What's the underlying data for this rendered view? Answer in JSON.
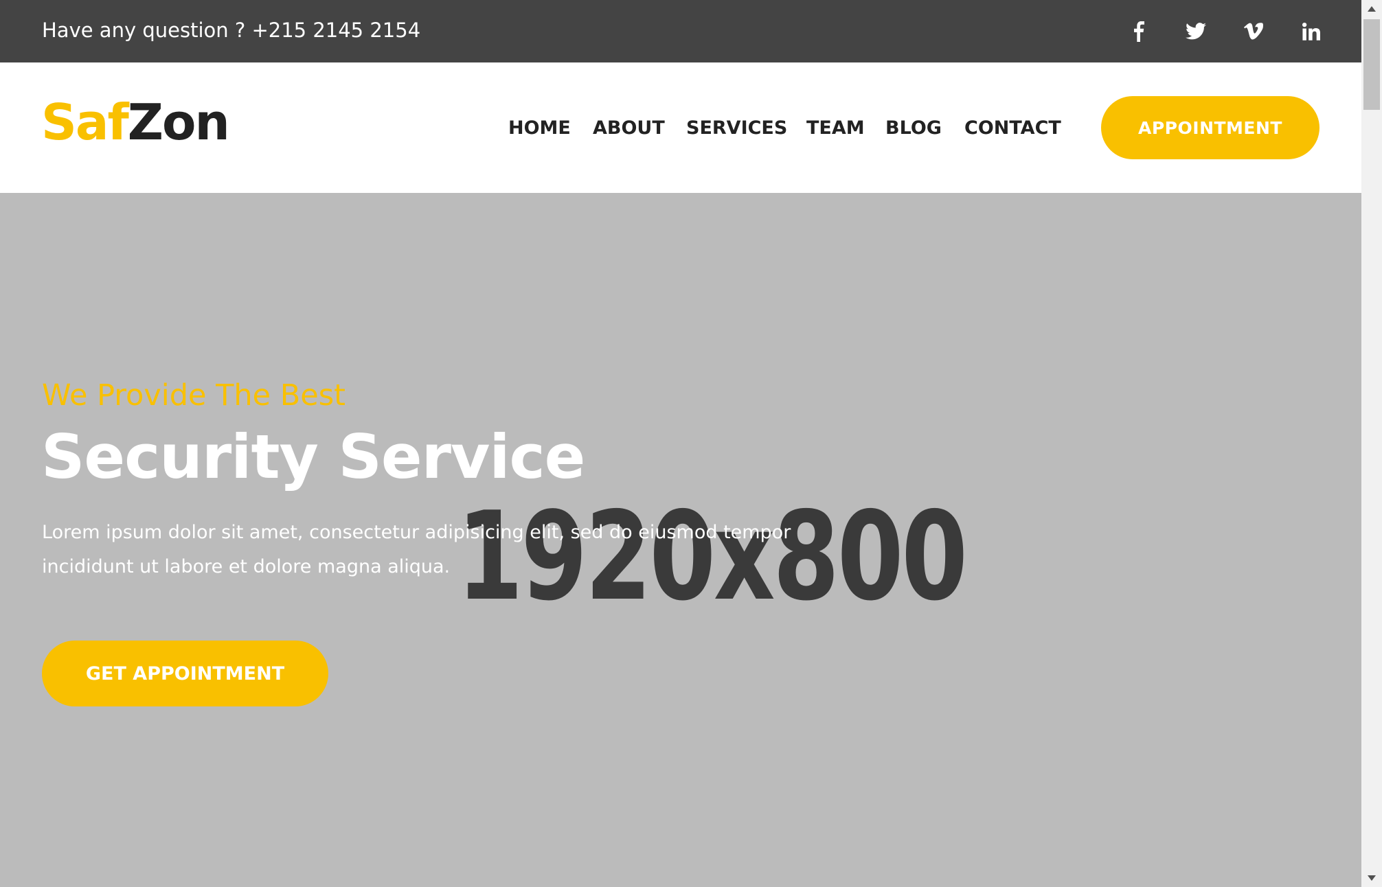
{
  "topbar": {
    "question": "Have any question ? +215 2145 2154",
    "social": [
      {
        "icon": "facebook-icon"
      },
      {
        "icon": "twitter-icon"
      },
      {
        "icon": "vimeo-icon"
      },
      {
        "icon": "linkedin-icon"
      }
    ]
  },
  "logo": {
    "part1": "Saf",
    "part2": "Zon"
  },
  "nav": {
    "items": [
      "HOME",
      "ABOUT",
      "SERVICES",
      "TEAM",
      "BLOG",
      "CONTACT"
    ],
    "cta": "APPOINTMENT"
  },
  "hero": {
    "placeholder": "1920x800",
    "tagline": "We Provide The Best",
    "headline": "Security Service",
    "lead": "Lorem ipsum dolor sit amet, consectetur adipisicing elit, sed do eiusmod tempor incididunt ut labore et dolore magna aliqua.",
    "button": "GET APPOINTMENT"
  },
  "colors": {
    "accent": "#f9c000",
    "topbar": "#444444",
    "hero_bg": "#bbbbbb",
    "dark_text": "#222222"
  }
}
